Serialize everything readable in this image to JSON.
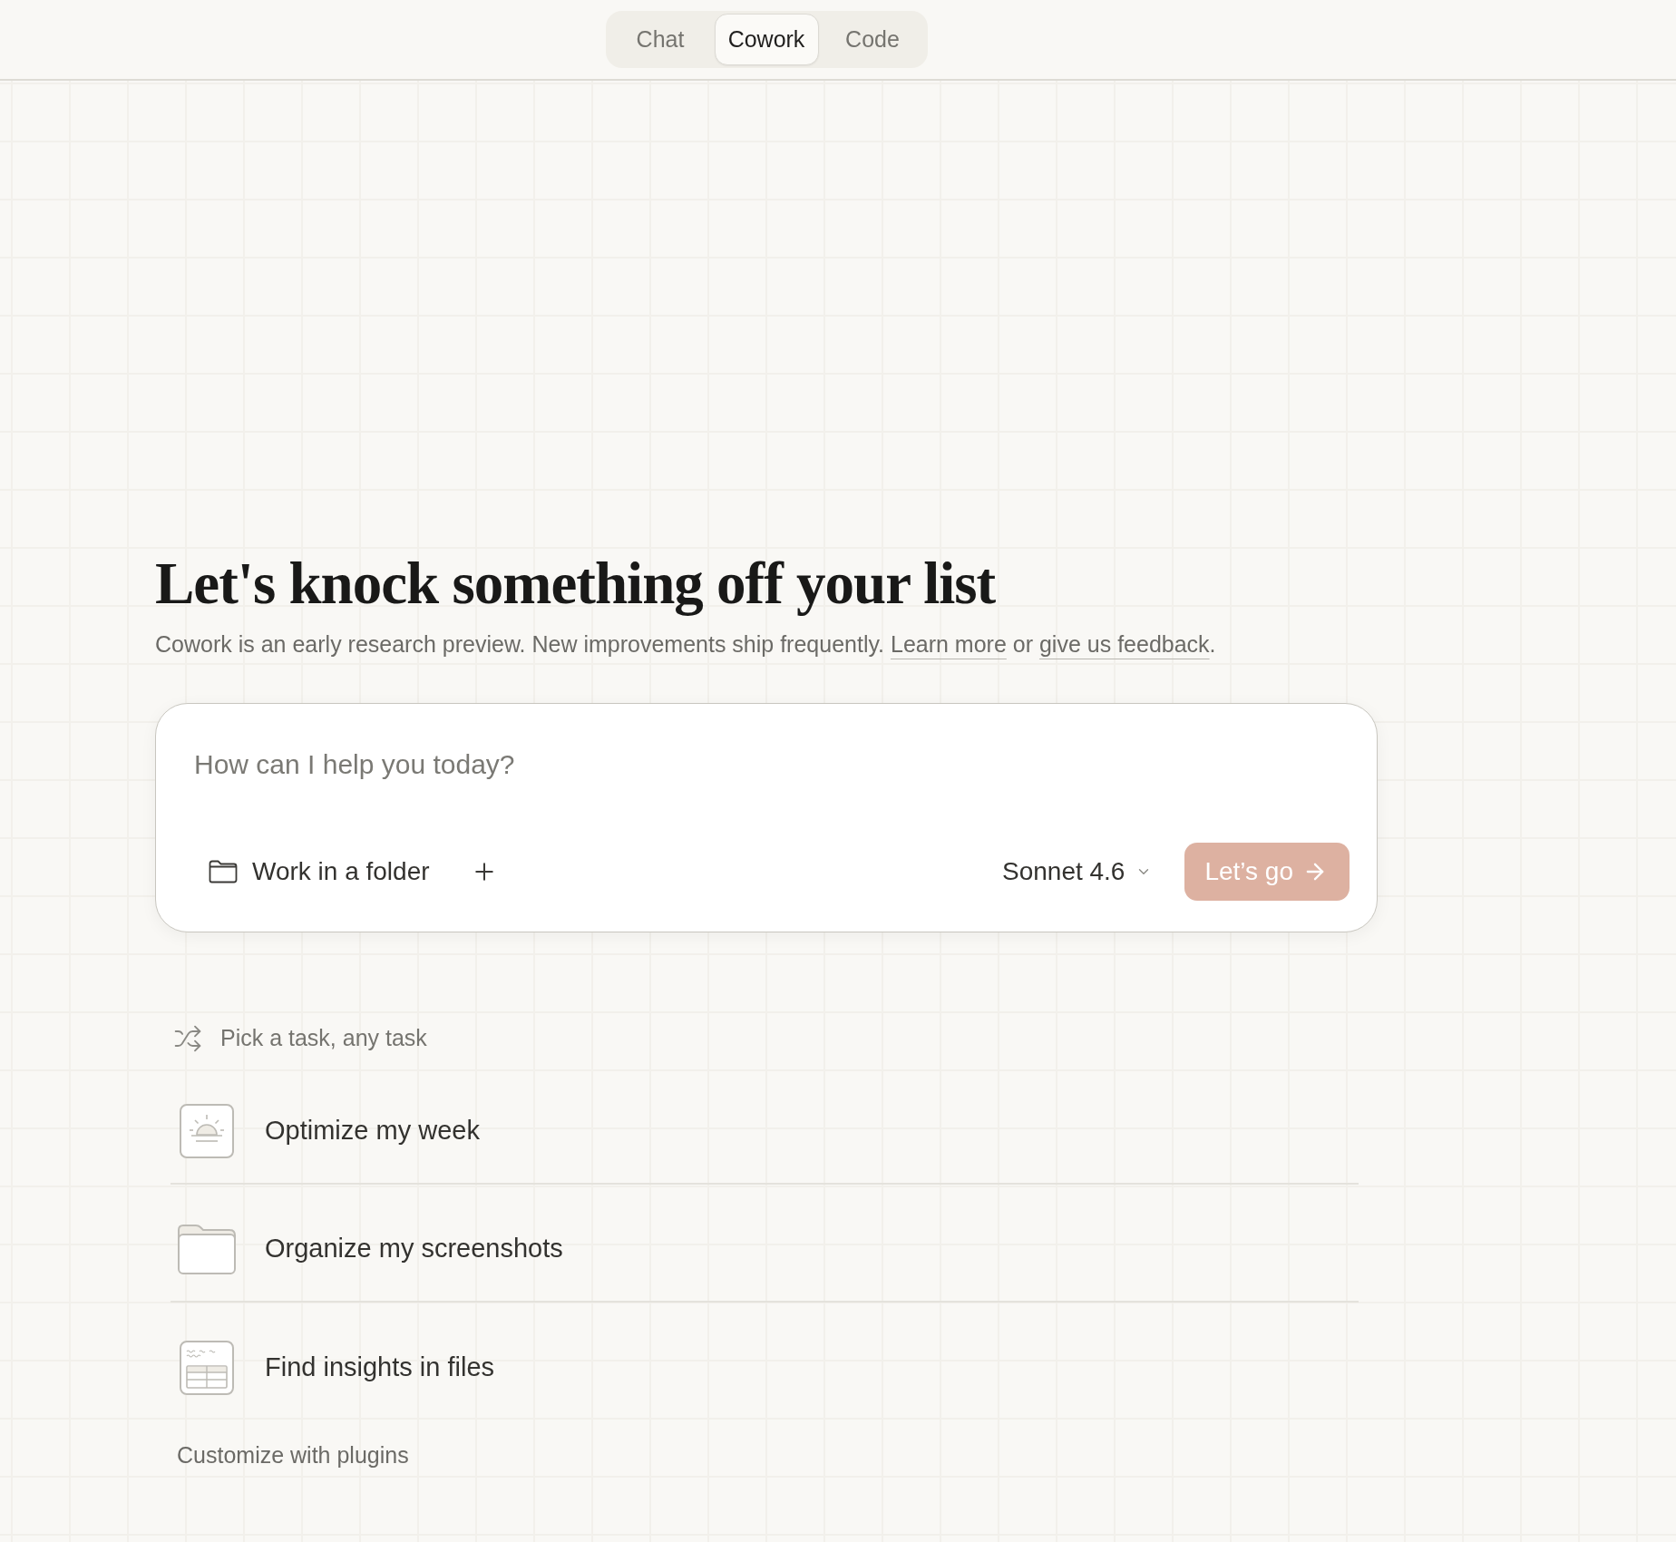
{
  "mode_tabs": [
    {
      "label": "Chat",
      "selected": false
    },
    {
      "label": "Cowork",
      "selected": true
    },
    {
      "label": "Code",
      "selected": false
    }
  ],
  "hero": {
    "title": "Let's knock something off your list",
    "subtitle": [
      {
        "kind": "text",
        "text": "Cowork is an early research preview. New improvements ship frequently. "
      },
      {
        "kind": "link",
        "text": "Learn more"
      },
      {
        "kind": "text",
        "text": " or "
      },
      {
        "kind": "link",
        "text": "give us feedback"
      },
      {
        "kind": "text",
        "text": "."
      }
    ]
  },
  "composer": {
    "placeholder": "How can I help you today?",
    "folder_button": "Work in a folder",
    "model": "Sonnet 4.6",
    "submit": {
      "label": "Let’s go",
      "disabled": true
    }
  },
  "tasks": {
    "heading": "Pick a task, any task",
    "items": [
      "Optimize my week",
      "Organize my screenshots",
      "Find insights in files"
    ],
    "footer_link": "Customize with plugins"
  }
}
